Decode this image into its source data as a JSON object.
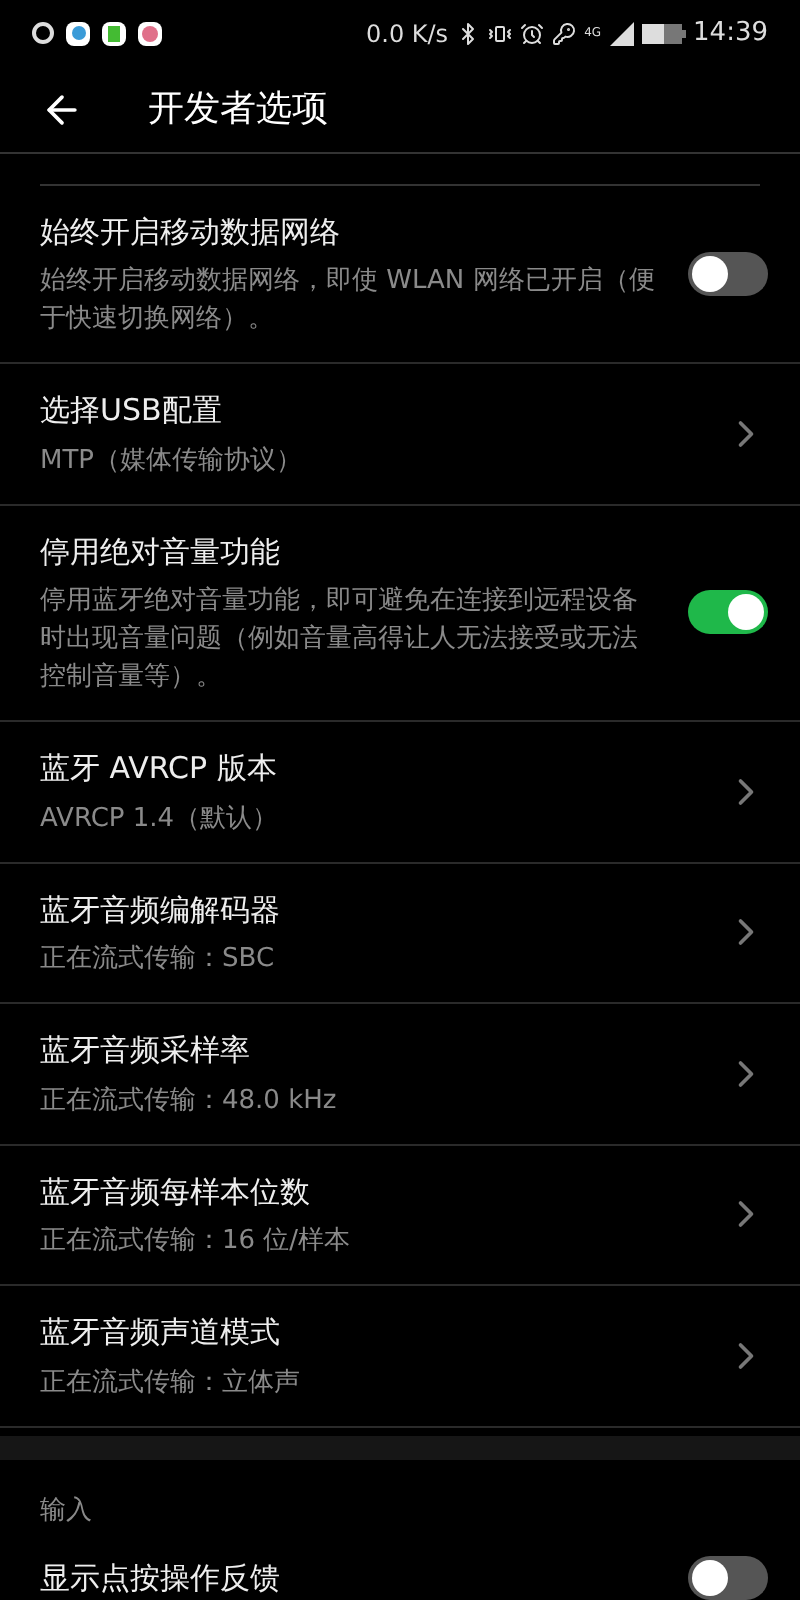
{
  "status_bar": {
    "speed": "0.0 K/s",
    "time": "14:39",
    "network": "4G"
  },
  "header": {
    "title": "开发者选项"
  },
  "items": [
    {
      "kind": "toggle",
      "title": "始终开启移动数据网络",
      "summary": "始终开启移动数据网络，即使 WLAN 网络已开启（便于快速切换网络）。",
      "on": false
    },
    {
      "kind": "link",
      "title": "选择USB配置",
      "summary": "MTP（媒体传输协议）"
    },
    {
      "kind": "toggle",
      "title": "停用绝对音量功能",
      "summary": "停用蓝牙绝对音量功能，即可避免在连接到远程设备时出现音量问题（例如音量高得让人无法接受或无法控制音量等）。",
      "on": true
    },
    {
      "kind": "link",
      "title": "蓝牙 AVRCP 版本",
      "summary": "AVRCP 1.4（默认）"
    },
    {
      "kind": "link",
      "title": "蓝牙音频编解码器",
      "summary": "正在流式传输：SBC"
    },
    {
      "kind": "link",
      "title": "蓝牙音频采样率",
      "summary": "正在流式传输：48.0 kHz"
    },
    {
      "kind": "link",
      "title": "蓝牙音频每样本位数",
      "summary": "正在流式传输：16 位/样本"
    },
    {
      "kind": "link",
      "title": "蓝牙音频声道模式",
      "summary": "正在流式传输：立体声"
    }
  ],
  "section": {
    "title": "输入"
  },
  "last_item": {
    "kind": "toggle",
    "title": "显示点按操作反馈",
    "on": false
  }
}
